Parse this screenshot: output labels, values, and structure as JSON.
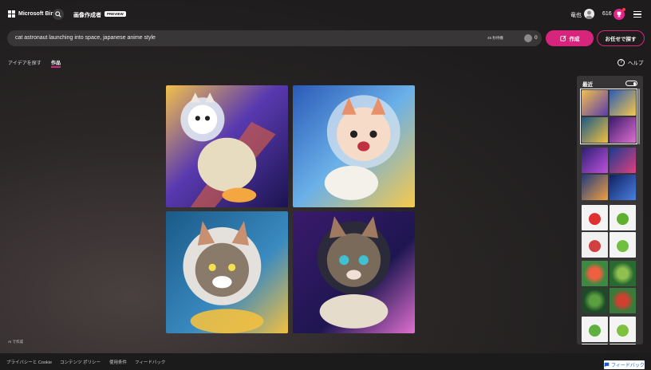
{
  "header": {
    "brand": "Microsoft Bing",
    "app_title": "画像作成者",
    "badge": "PREVIEW",
    "user_name": "竜也",
    "points": "616"
  },
  "prompt": {
    "value": "cat astronaut launching into space, japanese anime style",
    "timer": "45 秒待機",
    "boost_count": "0",
    "create_label": "作成",
    "surprise_label": "お任せで探す"
  },
  "tabs": [
    {
      "label": "アイデアを探す",
      "active": false
    },
    {
      "label": "作品",
      "active": true
    }
  ],
  "help_label": "ヘルプ",
  "images": [
    {
      "alt": "cat astronaut 1",
      "palette": [
        "#3a2a80",
        "#f4a640",
        "#e8dcc4"
      ]
    },
    {
      "alt": "cat astronaut 2",
      "palette": [
        "#4a7bd0",
        "#f6c94a",
        "#f4f0ea"
      ]
    },
    {
      "alt": "cat astronaut 3",
      "palette": [
        "#2a6aa0",
        "#f2c040",
        "#d8d2cc"
      ]
    },
    {
      "alt": "cat astronaut 4",
      "palette": [
        "#241a5c",
        "#e070d0",
        "#e6dccc"
      ]
    }
  ],
  "ai_label": "AI で作成",
  "recent": {
    "title": "最近",
    "toggle_on": true
  },
  "footer": {
    "links": [
      "プライバシーと Cookie",
      "コンテンツ ポリシー",
      "使用条件",
      "フィードバック"
    ]
  },
  "feedback_button": "フィードバック",
  "colors": {
    "accent": "#d7257d",
    "panel": "#373535",
    "prompt_bar": "#383636"
  }
}
